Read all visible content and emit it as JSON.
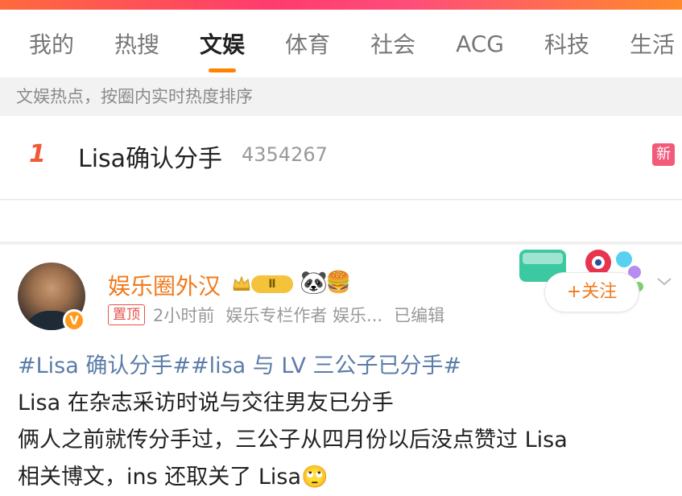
{
  "tabs": [
    {
      "label": "我的"
    },
    {
      "label": "热搜"
    },
    {
      "label": "文娱"
    },
    {
      "label": "体育"
    },
    {
      "label": "社会"
    },
    {
      "label": "ACG"
    },
    {
      "label": "科技"
    },
    {
      "label": "生活"
    }
  ],
  "active_tab": "文娱",
  "subheader": "文娱热点，按圈内实时热度排序",
  "hot_item": {
    "rank": "1",
    "title": "Lisa确认分手",
    "count": "4354267",
    "badge": "新"
  },
  "post": {
    "username": "娱乐圈外汉",
    "verified_badge": "V",
    "level_badge": "Ⅱ",
    "emoji_1": "🐼",
    "emoji_2": "🍔",
    "pin_tag": "置顶",
    "time": "2小时前",
    "author_role": "娱乐专栏作者 娱乐...",
    "edited": "已编辑",
    "follow_label": "+关注",
    "hashtags": "#Lisa 确认分手##lisa 与 LV 三公子已分手#",
    "line_1": "Lisa 在杂志采访时说与交往男友已分手",
    "line_2": "俩人之前就传分手过，三公子从四月份以后没点赞过 Lisa",
    "line_3": "相关博文，ins 还取关了 Lisa",
    "line_3_emoji": "🙄"
  },
  "colors": {
    "accent_orange": "#ff8200",
    "username_orange": "#f07a1c",
    "hashtag_blue": "#5b7ca8",
    "rank_red": "#f05a36",
    "new_badge": "#f25a7a"
  }
}
